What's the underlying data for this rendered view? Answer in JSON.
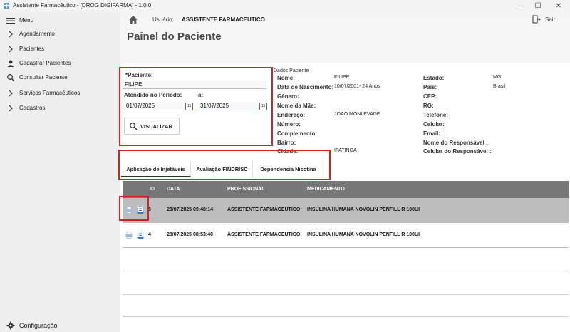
{
  "window": {
    "title": "Assistente Farmacêutico - [DROG DIGIFARMA] - 1.0.0",
    "minimize": "—",
    "maximize": "☐",
    "close": "✕"
  },
  "sidebar": {
    "menu_label": "Menu",
    "items": [
      {
        "label": "Agendamento",
        "icon": "chevron-right-icon"
      },
      {
        "label": "Pacientes",
        "icon": "chevron-right-icon"
      },
      {
        "label": "Cadastrar Pacientes",
        "icon": "user-icon"
      },
      {
        "label": "Consultar Paciente",
        "icon": "search-icon"
      },
      {
        "label": "Serviços Farmacêuticos",
        "icon": "chevron-right-icon"
      },
      {
        "label": "Cadastros",
        "icon": "chevron-right-icon"
      }
    ],
    "config_label": "Configuração"
  },
  "topbar": {
    "user_label": "Usuário:",
    "user_name": "ASSISTENTE FARMACEUTICO",
    "exit_label": "Sair"
  },
  "page": {
    "title": "Painel do Paciente"
  },
  "filter": {
    "patient_label": "*Paciente:",
    "patient_value": "FILIPE",
    "period_label": "Atendido no Período:",
    "to_label": "a:",
    "date_from": "01/07/2025",
    "date_to": "31/07/2025",
    "visualize_label": "VISUALIZAR"
  },
  "patient": {
    "section_title": "Dados Paciente",
    "left": [
      {
        "label": "Nome:",
        "value": "FILIPE"
      },
      {
        "label": "Data de Nascimento:",
        "value": "10/07/2001- 24 Anos"
      },
      {
        "label": "Gênero:",
        "value": ""
      },
      {
        "label": "Nome da Mãe:",
        "value": ""
      },
      {
        "label": "Endereço:",
        "value": "JOAO MONLEVADE"
      },
      {
        "label": "Número:",
        "value": ""
      },
      {
        "label": "Complemento:",
        "value": ""
      },
      {
        "label": "Bairro:",
        "value": ""
      },
      {
        "label": "Cidade:",
        "value": "IPATINGA"
      }
    ],
    "right": [
      {
        "label": "Estado:",
        "value": "MG"
      },
      {
        "label": "País:",
        "value": "Brasil"
      },
      {
        "label": "CEP:",
        "value": ""
      },
      {
        "label": "RG:",
        "value": ""
      },
      {
        "label": "Telefone:",
        "value": ""
      },
      {
        "label": "Celular:",
        "value": ""
      },
      {
        "label": "Email:",
        "value": ""
      },
      {
        "label": "Nome do Responsável :",
        "value": ""
      },
      {
        "label": "Celular do Responsável :",
        "value": ""
      }
    ]
  },
  "tabs": [
    {
      "label": "Aplicação de Injetáveis",
      "active": true
    },
    {
      "label": "Avaliação FINDRISC",
      "active": false
    },
    {
      "label": "Dependencia Nicotina",
      "active": false
    }
  ],
  "table": {
    "headers": {
      "id": "ID",
      "data": "DATA",
      "profissional": "PROFISSIONAL",
      "medicamento": "MEDICAMENTO"
    },
    "rows": [
      {
        "id": "5",
        "data": "28/07/2025 09:48:14",
        "profissional": "ASSISTENTE FARMACEUTICO",
        "medicamento": "INSULINA HUMANA NOVOLIN PENFILL R 100UI",
        "selected": true
      },
      {
        "id": "4",
        "data": "28/07/2025 08:53:40",
        "profissional": "ASSISTENTE FARMACEUTICO",
        "medicamento": "INSULINA HUMANA NOVOLIN PENFILL R 100UI",
        "selected": false
      }
    ]
  },
  "colors": {
    "highlight": "#d62020",
    "header_bg": "#777777",
    "selected_row": "#bdbdbd",
    "print_icon": "#4a90d9"
  }
}
